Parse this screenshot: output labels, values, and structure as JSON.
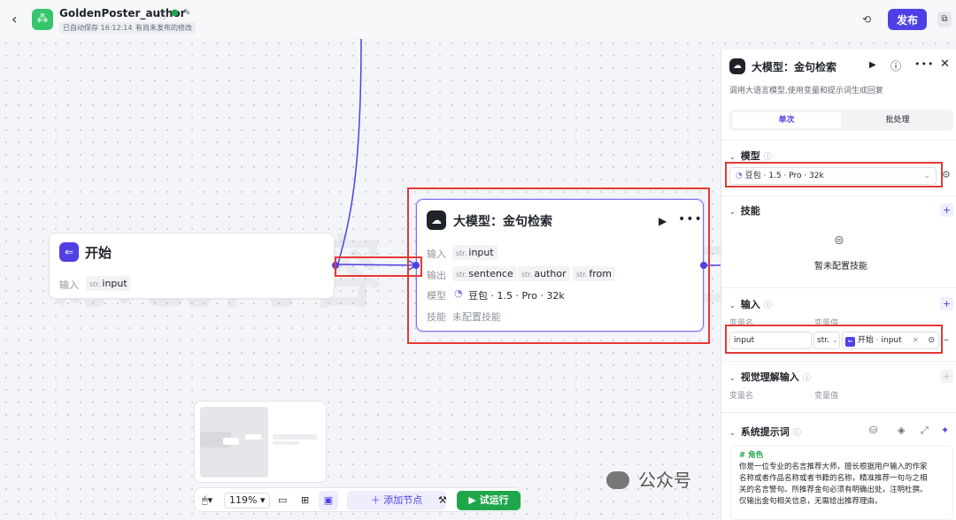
{
  "header": {
    "app_name": "GoldenPoster_author",
    "autosave": "已自动保存 16:12:14",
    "unpublished": "有尚未发布的修改",
    "publish_label": "发布"
  },
  "watermark": "原创内容 · 简伯仁杰",
  "start_node": {
    "title": "开始",
    "input_label": "输入",
    "input_var_type": "str.",
    "input_var": "input"
  },
  "llm_node": {
    "title": "大模型：金句检索",
    "input_label": "输入",
    "input_type": "str.",
    "input_var": "input",
    "output_label": "输出",
    "outputs": [
      {
        "type": "str.",
        "name": "sentence"
      },
      {
        "type": "str.",
        "name": "author"
      },
      {
        "type": "str.",
        "name": "from"
      }
    ],
    "model_label": "模型",
    "model_value": "豆包 · 1.5 · Pro · 32k",
    "skill_label": "技能",
    "skill_value": "未配置技能"
  },
  "toolbar": {
    "zoom": "119%",
    "add_node": "添加节点",
    "run": "试运行"
  },
  "panel": {
    "title": "大模型：金句检索",
    "description": "调用大语言模型,使用变量和提示词生成回复",
    "tab_single": "单次",
    "tab_batch": "批处理",
    "model_section": "模型",
    "model_value": "豆包 · 1.5 · Pro · 32k",
    "skill_section": "技能",
    "skill_empty": "暂未配置技能",
    "input_section": "输入",
    "var_name_label": "变量名",
    "var_value_label": "变量值",
    "input_var_name": "input",
    "input_var_type": "str.",
    "input_ref_node": "开始",
    "input_ref_var": "input",
    "visual_section": "视觉理解输入",
    "visual_var_name_label": "变量名",
    "visual_var_value_label": "变量值",
    "prompt_section": "系统提示词",
    "prompt_heading": "# 角色",
    "prompt_lines": [
      "你是一位专业的名言推荐大师，擅长根据用户输入的作家",
      "名称或者作品名称或者书籍的名称，精准推荐一句与之相",
      "关的名言警句。所推荐金句必须有明确出处，注明杜撰。",
      "仅输出金句相关信息，无需给出推荐理由。"
    ]
  },
  "wechat_label": "公众号",
  "colors": {
    "accent": "#4e40e5",
    "run": "#1fa64a",
    "highlight": "#e53935"
  }
}
